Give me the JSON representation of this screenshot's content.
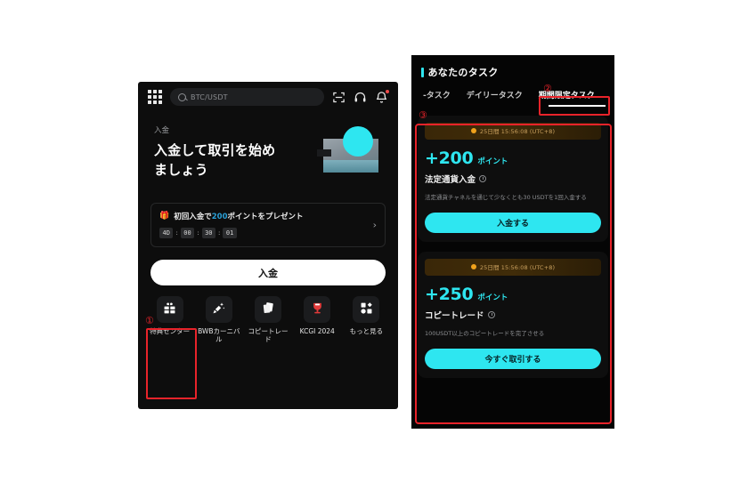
{
  "left_phone": {
    "topbar": {
      "menu_icon": "grid-menu-icon",
      "search": {
        "icon": "search-icon",
        "value": "BTC/USDT",
        "placeholder": "BTC/USDT"
      },
      "icons": [
        {
          "name": "scan-qr-icon",
          "badge": false
        },
        {
          "name": "headset-support-icon",
          "badge": false
        },
        {
          "name": "notification-bell-icon",
          "badge": true
        }
      ]
    },
    "hero": {
      "kicker": "入金",
      "title_line1": "入金して取引を始め",
      "title_line2": "ましょう",
      "art": "deposit-card-coin-illustration"
    },
    "promo": {
      "gift_icon": "gift-box-icon",
      "text_before": "初回入金で",
      "highlight": "200",
      "text_after": "ポイントをプレゼント",
      "highlight_color": "#2a9fd6",
      "timer": {
        "days": "4D",
        "hours": "00",
        "minutes": "30",
        "seconds": "01",
        "separator": ":"
      },
      "chevron": "chevron-right-icon"
    },
    "cta_button": "入金",
    "apps": [
      {
        "icon": "gift-center-icon",
        "label": "特典センター"
      },
      {
        "icon": "confetti-carnival-icon",
        "label": "BWBカーニバル"
      },
      {
        "icon": "copy-trade-cards-icon",
        "label": "コピートレード"
      },
      {
        "icon": "trophy-kcgi-icon",
        "label": "KCGI 2024"
      },
      {
        "icon": "more-grid-icon",
        "label": "もっと見る"
      }
    ]
  },
  "right_phone": {
    "header": {
      "title": "あなたのタスク",
      "accent_color": "#2ee6f0"
    },
    "tabs": [
      {
        "label": "-タスク",
        "active": false
      },
      {
        "label": "デイリータスク",
        "active": false
      },
      {
        "label": "期間限定タスク",
        "active": true
      }
    ],
    "cards": [
      {
        "timer_icon": "coin-icon",
        "timer_text": "25日間 15:56:08 (UTC+8)",
        "points": "+200",
        "points_unit": "ポイント",
        "task_name": "法定通貨入金",
        "info_icon": "info-circle-icon",
        "description": "法定通貨チャネルを通じて少なくとも30 USDTを1回入金する",
        "button_label": "入金する"
      },
      {
        "timer_icon": "coin-icon",
        "timer_text": "25日間 15:56:08 (UTC+8)",
        "points": "+250",
        "points_unit": "ポイント",
        "task_name": "コピートレード",
        "info_icon": "info-circle-icon",
        "description": "100USDT以上のコピートレードを完了させる",
        "button_label": "今すぐ取引する"
      }
    ]
  },
  "annotations": {
    "marker1": "①",
    "marker2": "②",
    "marker3": "③",
    "color": "#e8232a"
  }
}
